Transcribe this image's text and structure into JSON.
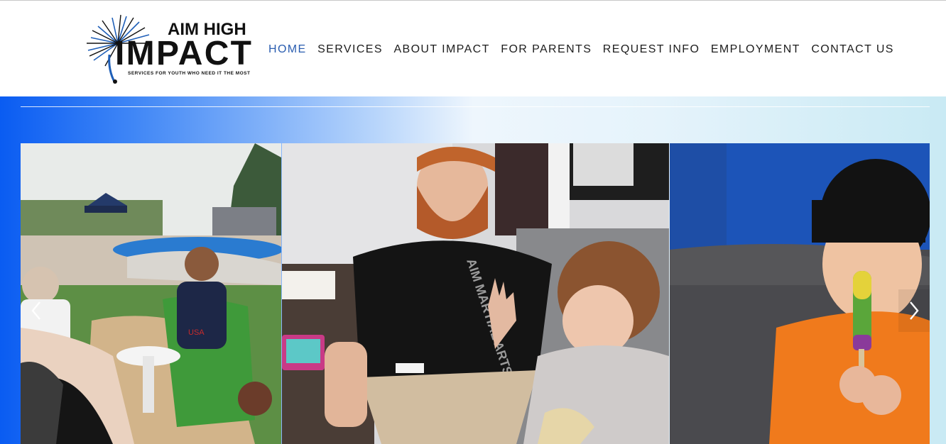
{
  "logo": {
    "line1": "AIM HIGH",
    "line2": "IMPACT",
    "tagline": "SERVICES FOR YOUTH WHO NEED IT THE MOST"
  },
  "nav": {
    "items": [
      {
        "label": "HOME",
        "active": true
      },
      {
        "label": "SERVICES",
        "active": false
      },
      {
        "label": "ABOUT IMPACT",
        "active": false
      },
      {
        "label": "FOR PARENTS",
        "active": false
      },
      {
        "label": "REQUEST INFO",
        "active": false
      },
      {
        "label": "EMPLOYMENT",
        "active": false
      },
      {
        "label": "CONTACT US",
        "active": false
      }
    ]
  },
  "slider": {
    "prev_icon": "chevron-left-icon",
    "next_icon": "chevron-right-icon",
    "slides": [
      {
        "photo": "kids-at-playground-photo"
      },
      {
        "photo": "coach-with-child-photo",
        "shirt_text": "AIM MARTIAL ARTS"
      },
      {
        "photo": "boy-with-popsicle-photo"
      }
    ]
  },
  "colors": {
    "nav_active": "#2a5db0",
    "nav_text": "#1d1d1d",
    "hero_gradient_start": "#0a5cf2",
    "hero_gradient_end": "#c9eaf4"
  }
}
